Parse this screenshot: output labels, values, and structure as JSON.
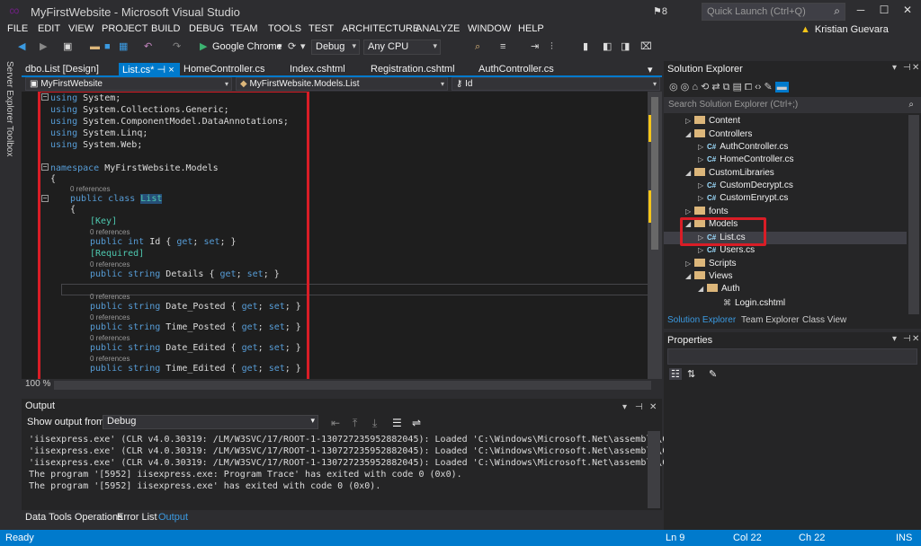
{
  "window": {
    "title": "MyFirstWebsite - Microsoft Visual Studio",
    "notification_count": "8",
    "quick_launch_placeholder": "Quick Launch (Ctrl+Q)",
    "user": "Kristian Guevara"
  },
  "menu": [
    "FILE",
    "EDIT",
    "VIEW",
    "PROJECT",
    "BUILD",
    "DEBUG",
    "TEAM",
    "TOOLS",
    "TEST",
    "ARCHITECTURE",
    "ANALYZE",
    "WINDOW",
    "HELP"
  ],
  "toolbar": {
    "run_target": "Google Chrome",
    "config": "Debug",
    "platform": "Any CPU"
  },
  "left_strip": {
    "server_explorer": "Server Explorer",
    "toolbox": "Toolbox"
  },
  "editor_tabs": [
    "dbo.List [Design]",
    "List.cs*",
    "HomeController.cs",
    "Index.cshtml",
    "Registration.cshtml",
    "AuthController.cs"
  ],
  "nav": {
    "project": "MyFirstWebsite",
    "class": "MyFirstWebsite.Models.List",
    "member": "Id"
  },
  "code": {
    "l1": "using System;",
    "l2": "using System.Collections.Generic;",
    "l3": "using System.ComponentModel.DataAnnotations;",
    "l4": "using System.Linq;",
    "l5": "using System.Web;",
    "ns": "namespace MyFirstWebsite.Models",
    "brace_open": "{",
    "refs": "0 references",
    "class_decl": "public class List",
    "key": "[Key]",
    "id_prop": "public int Id { get; set; }",
    "required": "[Required]",
    "details": "public string Details { get; set; }",
    "date_posted": "public string Date_Posted { get; set; }",
    "time_posted": "public string Time_Posted { get; set; }",
    "date_edited": "public string Date_Edited { get; set; }",
    "time_edited": "public string Time_Edited { get; set; }"
  },
  "zoom": "100 %",
  "output": {
    "title": "Output",
    "show_from_label": "Show output from:",
    "source": "Debug",
    "lines": [
      "'iisexpress.exe' (CLR v4.0.30319: /LM/W3SVC/17/ROOT-1-130727235952882045): Loaded 'C:\\Windows\\Microsoft.Net\\assembly\\GAC_MS",
      "'iisexpress.exe' (CLR v4.0.30319: /LM/W3SVC/17/ROOT-1-130727235952882045): Loaded 'C:\\Windows\\Microsoft.Net\\assembly\\GAC_MS",
      "'iisexpress.exe' (CLR v4.0.30319: /LM/W3SVC/17/ROOT-1-130727235952882045): Loaded 'C:\\Windows\\Microsoft.Net\\assembly\\GAC_MS",
      "The program '[5952] iisexpress.exe: Program Trace' has exited with code 0 (0x0).",
      "The program '[5952] iisexpress.exe' has exited with code 0 (0x0)."
    ]
  },
  "bottom_tabs": [
    "Data Tools Operations",
    "Error List",
    "Output"
  ],
  "solution_explorer": {
    "title": "Solution Explorer",
    "search_placeholder": "Search Solution Explorer (Ctrl+;)",
    "tree": [
      {
        "label": "Content",
        "kind": "folder"
      },
      {
        "label": "Controllers",
        "kind": "folder"
      },
      {
        "label": "AuthController.cs",
        "kind": "cs"
      },
      {
        "label": "HomeController.cs",
        "kind": "cs"
      },
      {
        "label": "CustomLibraries",
        "kind": "folder"
      },
      {
        "label": "CustomDecrypt.cs",
        "kind": "cs"
      },
      {
        "label": "CustomEnrypt.cs",
        "kind": "cs"
      },
      {
        "label": "fonts",
        "kind": "folder"
      },
      {
        "label": "Models",
        "kind": "folder"
      },
      {
        "label": "List.cs",
        "kind": "cs"
      },
      {
        "label": "Users.cs",
        "kind": "cs"
      },
      {
        "label": "Scripts",
        "kind": "folder"
      },
      {
        "label": "Views",
        "kind": "folder"
      },
      {
        "label": "Auth",
        "kind": "folder"
      },
      {
        "label": "Login.cshtml",
        "kind": "cshtml"
      }
    ],
    "tabs": [
      "Solution Explorer",
      "Team Explorer",
      "Class View"
    ]
  },
  "properties": {
    "title": "Properties"
  },
  "status": {
    "state": "Ready",
    "ln": "Ln 9",
    "col": "Col 22",
    "ch": "Ch 22",
    "mode": "INS"
  },
  "colors": {
    "accent": "#007acc",
    "highlight_box": "#d91d26"
  }
}
